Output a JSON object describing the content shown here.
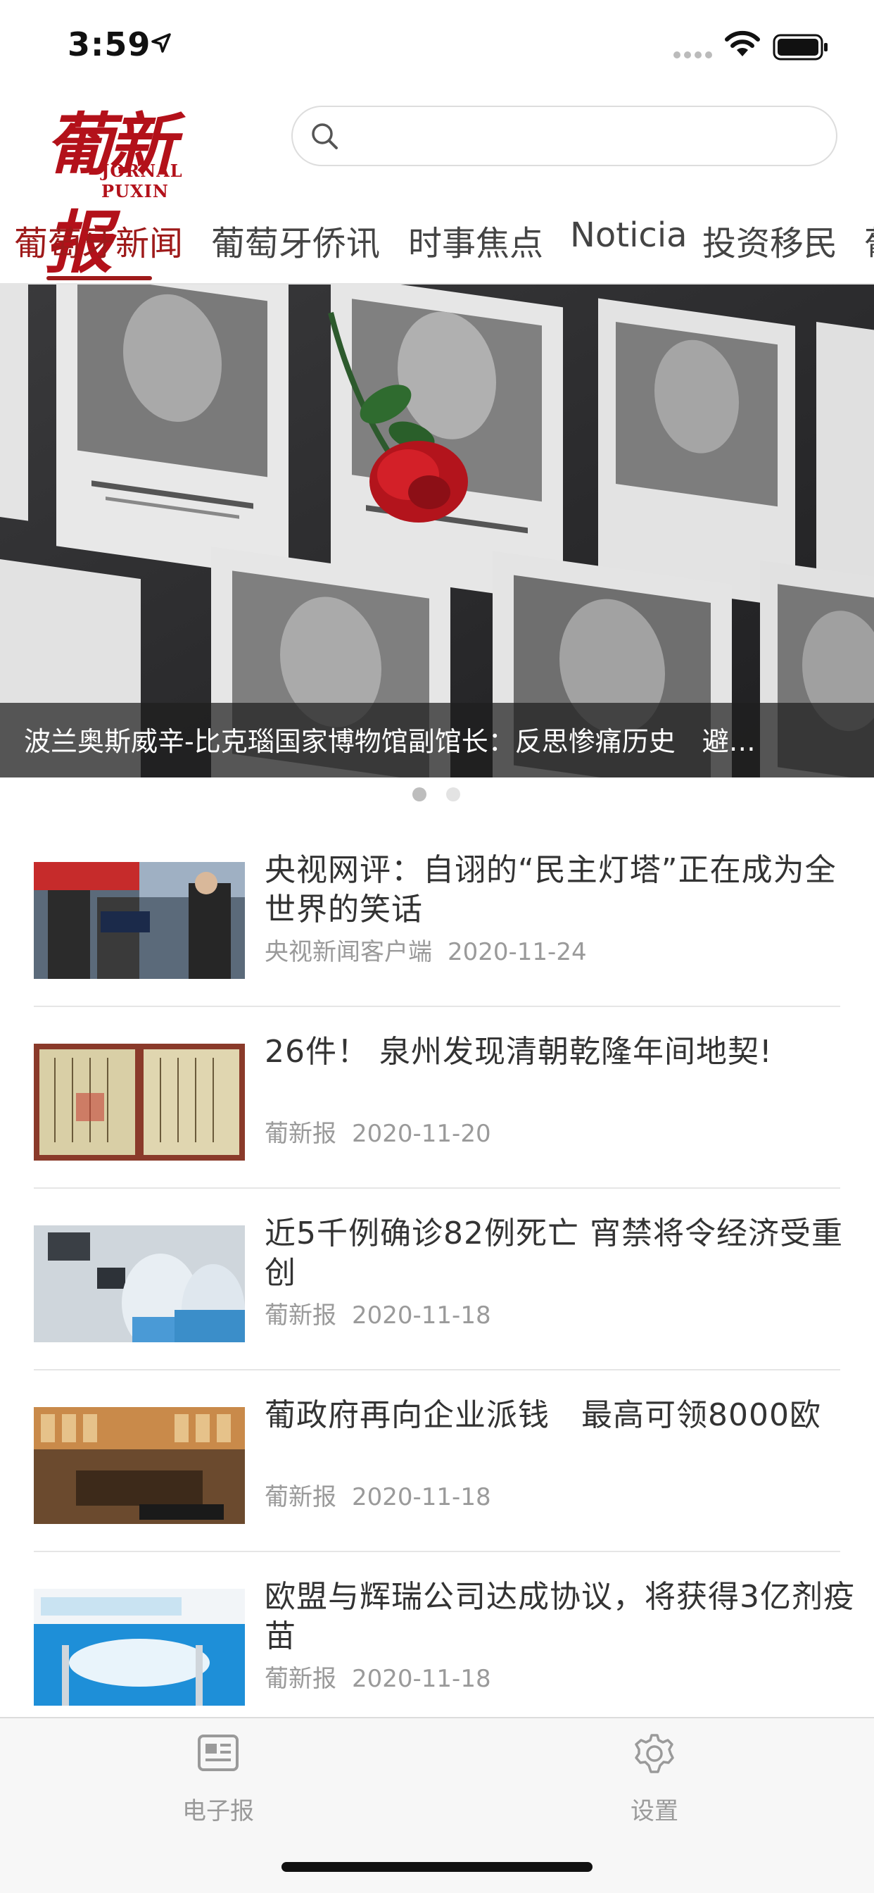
{
  "status_bar": {
    "time": "3:59"
  },
  "header": {
    "logo_text_cn": "葡新报",
    "logo_text_en": "JORNAL PUXIN",
    "search_placeholder": ""
  },
  "tabs": [
    {
      "label": "葡萄牙新闻",
      "active": true
    },
    {
      "label": "葡萄牙侨讯",
      "active": false
    },
    {
      "label": "时事焦点",
      "active": false
    },
    {
      "label": "Noticia",
      "active": false
    },
    {
      "label": "投资移民",
      "active": false
    },
    {
      "label": "葡",
      "active": false
    }
  ],
  "banner": {
    "caption": "波兰奥斯威辛-比克瑙国家博物馆副馆长：反思惨痛历史　避…",
    "page_count": 2,
    "current_page": 1
  },
  "news": [
    {
      "title": "央视网评：自诩的“民主灯塔”正在成为全世界的笑话",
      "source": "央视新闻客户端",
      "date": "2020-11-24"
    },
    {
      "title": "26件！ 泉州发现清朝乾隆年间地契!",
      "source": "葡新报",
      "date": "2020-11-20"
    },
    {
      "title": "近5千例确诊82例死亡 宵禁将令经济受重创",
      "source": "葡新报",
      "date": "2020-11-18"
    },
    {
      "title": "葡政府再向企业派钱　最高可领8000欧",
      "source": "葡新报",
      "date": "2020-11-18"
    },
    {
      "title": "欧盟与辉瑞公司达成协议，将获得3亿剂疫苗",
      "source": "葡新报",
      "date": "2020-11-18"
    }
  ],
  "tabbar": {
    "items": [
      {
        "label": "电子报",
        "icon": "newspaper-icon"
      },
      {
        "label": "设置",
        "icon": "gear-icon"
      }
    ]
  },
  "colors": {
    "accent": "#9e1a1a",
    "logo": "#b3111a"
  }
}
